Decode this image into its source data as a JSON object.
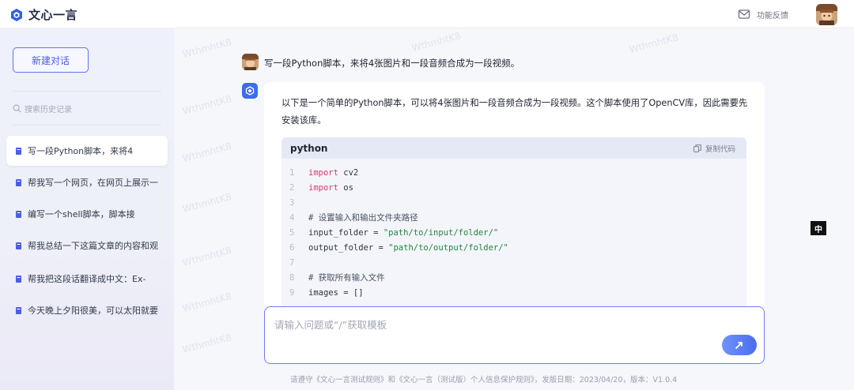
{
  "app": {
    "name": "文心一言",
    "feedback_label": "功能反馈"
  },
  "sidebar": {
    "new_chat_label": "新建对话",
    "search_placeholder": "搜索历史记录",
    "history": [
      {
        "label": "写一段Python脚本，来将4",
        "active": true
      },
      {
        "label": "帮我写一个网页，在网页上展示一",
        "active": false
      },
      {
        "label": "编写一个shell脚本，脚本接",
        "active": false
      },
      {
        "label": "帮我总结一下这篇文章的内容和观",
        "active": false
      },
      {
        "label": "帮我把这段话翻译成中文：Ex-",
        "active": false
      },
      {
        "label": "今天晚上夕阳很美，可以太阳就要",
        "active": false
      }
    ]
  },
  "conversation": {
    "user_message": "写一段Python脚本，来将4张图片和一段音频合成为一段视频。",
    "bot_intro": "以下是一个简单的Python脚本，可以将4张图片和一段音频合成为一段视频。这个脚本使用了OpenCV库，因此需要先安装该库。",
    "code": {
      "language": "python",
      "copy_label": "复制代码",
      "lines": [
        {
          "n": "1",
          "parts": [
            {
              "t": "import",
              "c": "kw"
            },
            {
              "t": " cv2",
              "c": "plain"
            }
          ]
        },
        {
          "n": "2",
          "parts": [
            {
              "t": "import",
              "c": "kw"
            },
            {
              "t": " os",
              "c": "plain"
            }
          ]
        },
        {
          "n": "3",
          "parts": []
        },
        {
          "n": "4",
          "parts": [
            {
              "t": "# 设置输入和输出文件夹路径",
              "c": "cm"
            }
          ]
        },
        {
          "n": "5",
          "parts": [
            {
              "t": "input_folder = ",
              "c": "plain"
            },
            {
              "t": "\"path/to/input/folder/\"",
              "c": "str"
            }
          ]
        },
        {
          "n": "6",
          "parts": [
            {
              "t": "output_folder = ",
              "c": "plain"
            },
            {
              "t": "\"path/to/output/folder/\"",
              "c": "str"
            }
          ]
        },
        {
          "n": "7",
          "parts": []
        },
        {
          "n": "8",
          "parts": [
            {
              "t": "# 获取所有输入文件",
              "c": "cm"
            }
          ]
        },
        {
          "n": "9",
          "parts": [
            {
              "t": "images = []",
              "c": "plain"
            }
          ]
        }
      ]
    }
  },
  "input": {
    "placeholder": "请输入问题或“/”获取模板"
  },
  "footer": "请遵守《文心一言测试规则》和《文心一言（测试版）个人信息保护规则》，发版日期：2023/04/20，版本：V1.0.4",
  "watermark_text": "WthmhtK8",
  "ime_badge": "中",
  "colors": {
    "accent": "#4a5ce8",
    "keyword": "#d73a6a",
    "string": "#22863a",
    "sidebar_bg": "#eef0fb"
  }
}
